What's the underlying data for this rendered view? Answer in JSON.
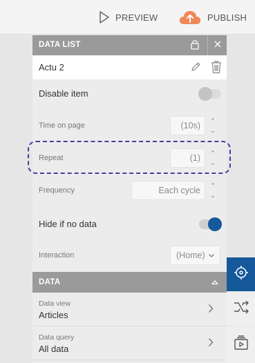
{
  "topbar": {
    "preview_label": "PREVIEW",
    "publish_label": "PUBLISH"
  },
  "panel": {
    "header_title": "DATA LIST",
    "item_name": "Actu 2",
    "disable_item_label": "Disable item",
    "disable_item_on": false,
    "time_on_page_label": "Time on page",
    "time_on_page_value": "(10s)",
    "repeat_label": "Repeat",
    "repeat_value": "(1)",
    "frequency_label": "Frequency",
    "frequency_value": "Each cycle",
    "hide_if_no_data_label": "Hide if no data",
    "hide_if_no_data_on": true,
    "interaction_label": "Interaction",
    "interaction_value": "(Home)"
  },
  "data_section": {
    "title": "DATA",
    "rows": [
      {
        "label": "Data view",
        "value": "Articles"
      },
      {
        "label": "Data query",
        "value": "All data"
      }
    ]
  },
  "colors": {
    "accent": "#15599a",
    "header_gray": "#9a9a9a",
    "highlight_dash": "#4b3a9e",
    "publish_cloud": "#f0885a"
  },
  "icons": [
    "play-icon",
    "cloud-upload-icon",
    "lock-icon",
    "close-icon",
    "pencil-icon",
    "trash-icon",
    "chevron-up-icon",
    "chevron-down-icon",
    "chevron-right-icon",
    "target-icon",
    "flow-icon",
    "slides-icon"
  ]
}
